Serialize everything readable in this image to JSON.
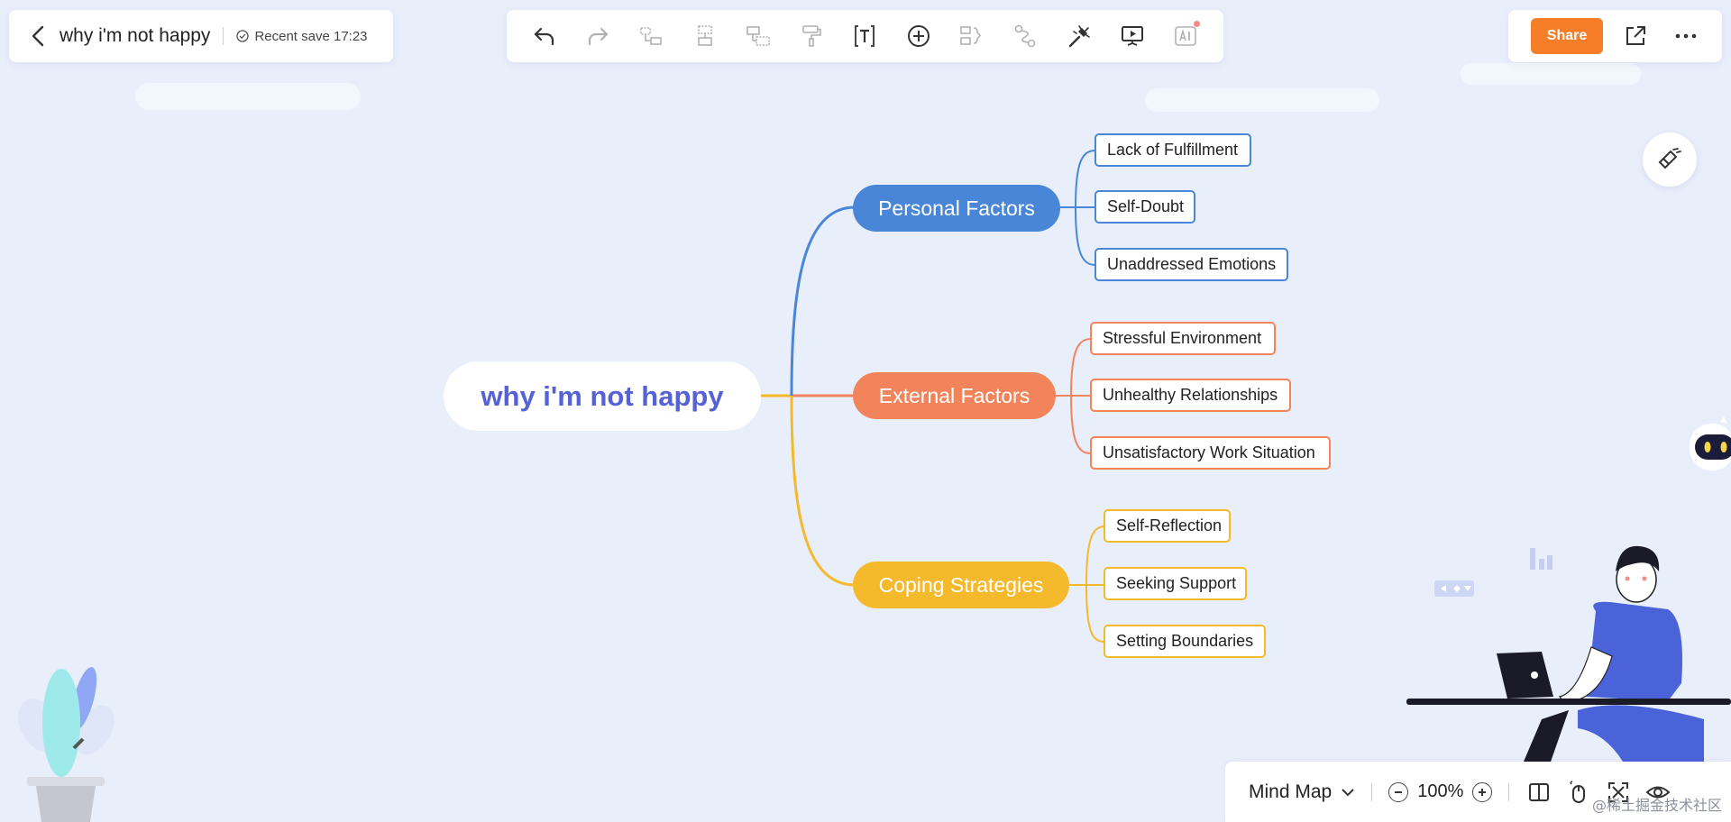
{
  "header": {
    "doc_title": "why i'm not happy",
    "save_status": "Recent save 17:23"
  },
  "toolbar": {
    "tools": [
      "undo-icon",
      "redo-icon",
      "sub-topic-icon",
      "sibling-topic-icon",
      "floating-topic-icon",
      "format-painter-icon",
      "text-icon",
      "insert-icon",
      "summary-icon",
      "relationship-icon",
      "style-icon",
      "presentation-icon",
      "ai-icon"
    ]
  },
  "actions": {
    "share_label": "Share"
  },
  "mindmap": {
    "root": "why i'm not happy",
    "branches": [
      {
        "label": "Personal Factors",
        "color": "#4a86d8",
        "children": [
          "Lack of Fulfillment",
          "Self-Doubt",
          "Unaddressed Emotions"
        ]
      },
      {
        "label": "External Factors",
        "color": "#f2845c",
        "children": [
          "Stressful Environment",
          "Unhealthy Relationships",
          "Unsatisfactory Work Situation"
        ]
      },
      {
        "label": "Coping Strategies",
        "color": "#f5b92c",
        "children": [
          "Self-Reflection",
          "Seeking Support",
          "Setting Boundaries"
        ]
      }
    ]
  },
  "bottom_bar": {
    "layout_label": "Mind Map",
    "zoom_level": "100%"
  },
  "watermark": "@稀土掘金技术社区",
  "colors": {
    "background": "#e9eefb",
    "accent": "#f67e28",
    "root_text": "#5561d6"
  }
}
